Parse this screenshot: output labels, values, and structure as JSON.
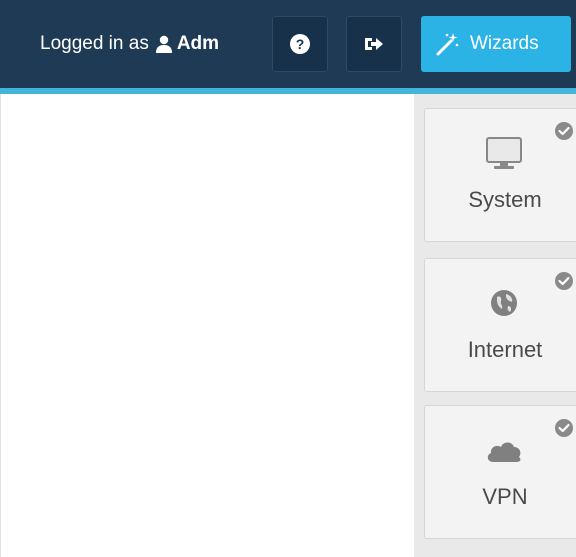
{
  "header": {
    "logged_in_prefix": "Logged in as",
    "user_name": "Adm",
    "user_icon": "user-icon",
    "help_icon": "question-circle-icon",
    "logout_icon": "sign-out-icon",
    "wizards_label": "Wizards",
    "wizards_icon": "magic-wand-icon"
  },
  "tiles": [
    {
      "label": "System",
      "icon": "monitor-icon",
      "status": "check-circle-icon"
    },
    {
      "label": "Internet",
      "icon": "globe-icon",
      "status": "check-circle-icon"
    },
    {
      "label": "VPN",
      "icon": "cloud-icon",
      "status": "check-circle-icon"
    }
  ],
  "colors": {
    "header_bg": "#1f3a55",
    "accent": "#3fb6da",
    "wizard_button": "#2bb3e6",
    "tile_bg": "#f3f3f3"
  }
}
